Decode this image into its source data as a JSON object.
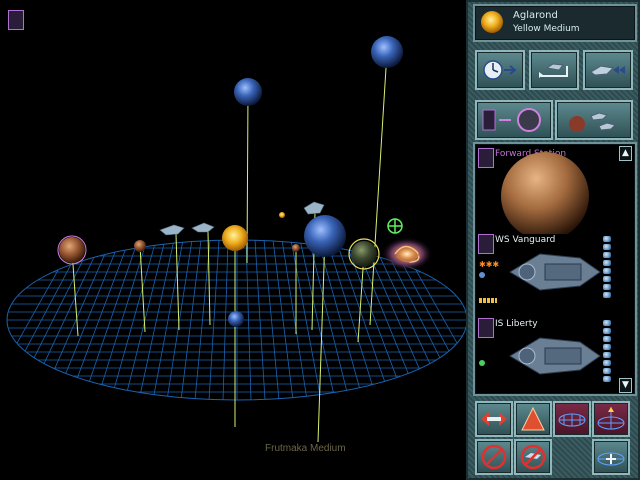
{
  "system": {
    "name": "Aglarond",
    "star_type": "Yellow Medium",
    "star_color": "#f0b020"
  },
  "viewport": {
    "secondary_star_label": "Frutmaka Medium",
    "grid_color": "#1a63b0",
    "stalk_color": "#d8f070"
  },
  "toolbar": {
    "buttons": [
      {
        "name": "end-turn-button",
        "icon": "clock-arrow-icon"
      },
      {
        "name": "transfer-button",
        "icon": "transfer-icon"
      },
      {
        "name": "fleet-move-button",
        "icon": "fleet-arrow-icon"
      }
    ],
    "view_buttons": [
      {
        "name": "planet-view-button",
        "icon": "planet-ring-icon"
      },
      {
        "name": "fleet-view-button",
        "icon": "ships-planet-icon"
      }
    ]
  },
  "object_list": {
    "items": [
      {
        "label": "Forward Station",
        "kind": "station"
      },
      {
        "label": "WS Vanguard",
        "kind": "ship",
        "status_color": "#ff8c20"
      },
      {
        "label": "IS Liberty",
        "kind": "ship",
        "status_color": "#48d060"
      }
    ],
    "scroll_up": "▲",
    "scroll_down": "▼"
  },
  "bottom_controls": {
    "buttons": [
      {
        "name": "zoom-out-button",
        "icon": "double-arrow-icon"
      },
      {
        "name": "pyramid-view-button",
        "icon": "pyramid-icon"
      },
      {
        "name": "grid-flat-button",
        "icon": "grid-flat-icon"
      },
      {
        "name": "grid-axis-button",
        "icon": "grid-axis-icon"
      },
      {
        "name": "no-fire-button",
        "icon": "no-fire-icon"
      },
      {
        "name": "no-ship-button",
        "icon": "no-ship-icon"
      },
      {
        "name": "grid-center-button",
        "icon": "grid-center-icon"
      }
    ]
  }
}
